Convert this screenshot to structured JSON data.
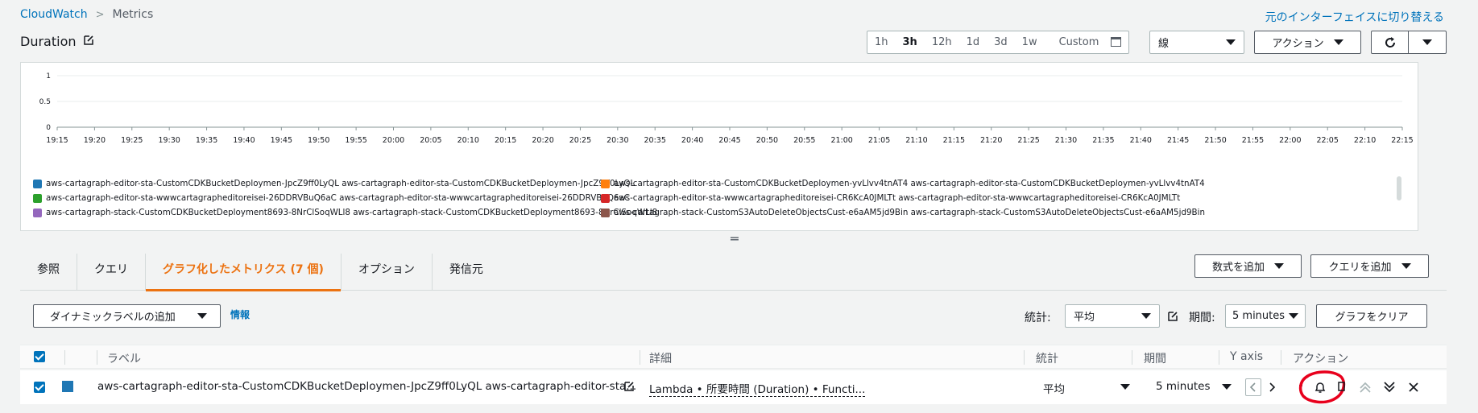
{
  "breadcrumb": {
    "root": "CloudWatch",
    "current": "Metrics"
  },
  "header": {
    "switch_link": "元のインターフェイスに切り替える",
    "title": "Duration"
  },
  "toolbar": {
    "time_ranges": [
      "1h",
      "3h",
      "12h",
      "1d",
      "3d",
      "1w",
      "Custom"
    ],
    "active_time_range": "3h",
    "chart_type": "線",
    "actions_label": "アクション"
  },
  "chart_data": {
    "type": "line",
    "y_ticks": [
      "1",
      "0.5",
      "0"
    ],
    "ylim": [
      0,
      1
    ],
    "x_ticks": [
      "19:15",
      "19:20",
      "19:25",
      "19:30",
      "19:35",
      "19:40",
      "19:45",
      "19:50",
      "19:55",
      "20:00",
      "20:05",
      "20:10",
      "20:15",
      "20:20",
      "20:25",
      "20:30",
      "20:35",
      "20:40",
      "20:45",
      "20:50",
      "20:55",
      "21:00",
      "21:05",
      "21:10",
      "21:15",
      "21:20",
      "21:25",
      "21:30",
      "21:35",
      "21:40",
      "21:45",
      "21:50",
      "21:55",
      "22:00",
      "22:05",
      "22:10",
      "22:15"
    ],
    "grid": true,
    "legend_position": "bottom",
    "series": [
      {
        "name": "aws-cartagraph-editor-sta-CustomCDKBucketDeploymen-JpcZ9ff0LyQL aws-cartagraph-editor-sta-CustomCDKBucketDeploymen-JpcZ9ff0LyQL",
        "color": "#1f77b4",
        "values": []
      },
      {
        "name": "aws-cartagraph-editor-sta-CustomCDKBucketDeploymen-yvLlvv4tnAT4 aws-cartagraph-editor-sta-CustomCDKBucketDeploymen-yvLlvv4tnAT4",
        "color": "#ff7f0e",
        "values": []
      },
      {
        "name": "aws-cartagraph-editor-sta-wwwcartagrapheditoreisei-26DDRVBuQ6aC aws-cartagraph-editor-sta-wwwcartagrapheditoreisei-26DDRVBuQ6aC",
        "color": "#2ca02c",
        "values": []
      },
      {
        "name": "aws-cartagraph-editor-sta-wwwcartagrapheditoreisei-CR6KcA0JMLTt aws-cartagraph-editor-sta-wwwcartagrapheditoreisei-CR6KcA0JMLTt",
        "color": "#d62728",
        "values": []
      },
      {
        "name": "aws-cartagraph-stack-CustomCDKBucketDeployment8693-8NrClSoqWLl8 aws-cartagraph-stack-CustomCDKBucketDeployment8693-8NrClSoqWLl8",
        "color": "#9467bd",
        "values": []
      },
      {
        "name": "aws-cartagraph-stack-CustomS3AutoDeleteObjectsCust-e6aAM5jd9Bin aws-cartagraph-stack-CustomS3AutoDeleteObjectsCust-e6aAM5jd9Bin",
        "color": "#8c564b",
        "values": []
      }
    ]
  },
  "tabs": [
    {
      "label": "参照"
    },
    {
      "label": "クエリ"
    },
    {
      "label": "グラフ化したメトリクス (7 個)",
      "active": true
    },
    {
      "label": "オプション"
    },
    {
      "label": "発信元"
    }
  ],
  "tab_actions": {
    "add_math": "数式を追加",
    "add_query": "クエリを追加"
  },
  "metrics_toolbar": {
    "dynamic_label": "ダイナミックラベルの追加",
    "info": "情報",
    "stat_label": "統計:",
    "stat_value": "平均",
    "period_label": "期間:",
    "period_value": "5 minutes",
    "clear_graph": "グラフをクリア"
  },
  "table": {
    "headers": {
      "label": "ラベル",
      "details": "詳細",
      "stat": "統計",
      "period": "期間",
      "yaxis": "Y axis",
      "actions": "アクション"
    },
    "rows": [
      {
        "color": "#1f77b4",
        "label": "aws-cartagraph-editor-sta-CustomCDKBucketDeploymen-JpcZ9ff0LyQL aws-cartagraph-editor-sta...",
        "details": "Lambda • 所要時間 (Duration) • Functi...",
        "stat": "平均",
        "period": "5 minutes"
      }
    ]
  },
  "colors": {
    "accent": "#ec7211",
    "link": "#0073bb",
    "annotation": "#e8001c"
  }
}
